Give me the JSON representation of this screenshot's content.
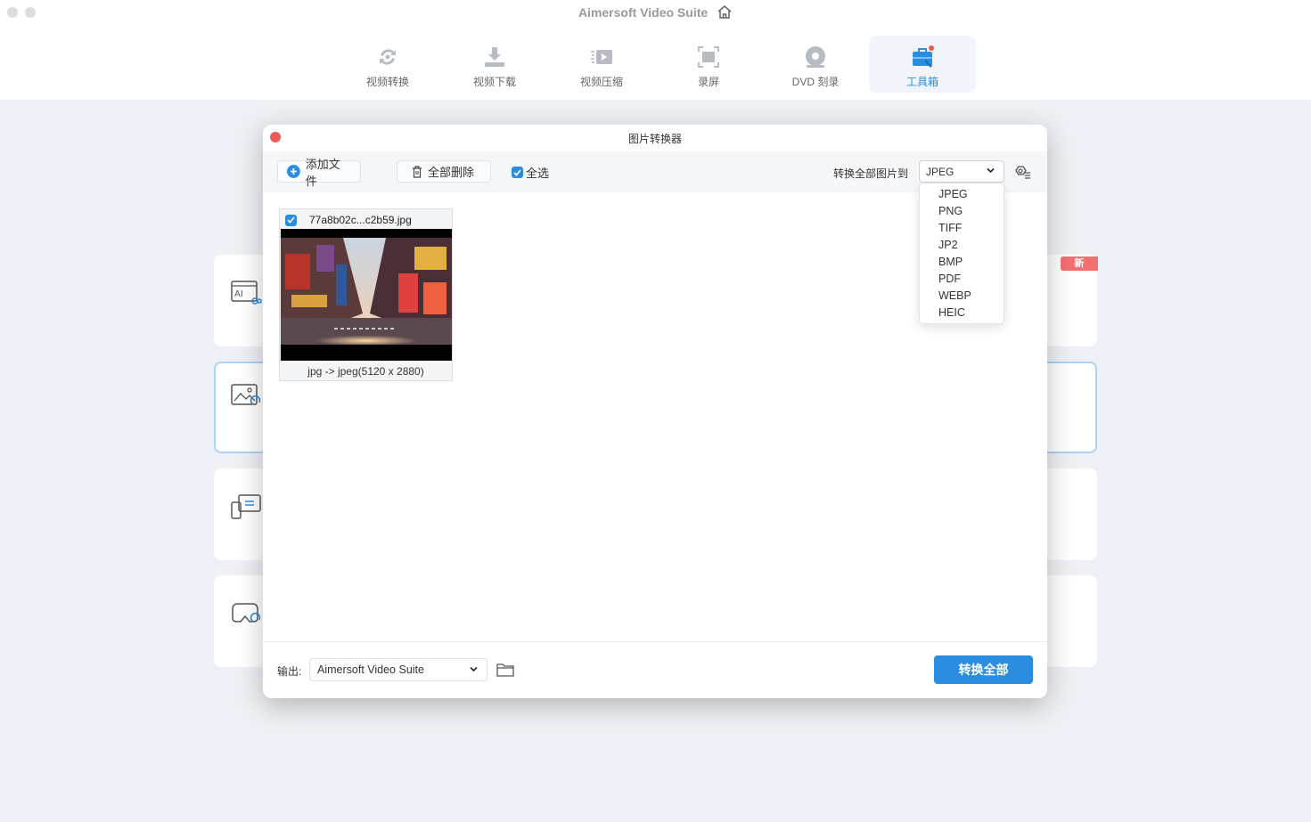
{
  "app": {
    "title": "Aimersoft Video Suite"
  },
  "nav": {
    "items": [
      {
        "label": "视频转换",
        "icon": "convert-icon"
      },
      {
        "label": "视频下载",
        "icon": "download-icon"
      },
      {
        "label": "视频压缩",
        "icon": "compress-icon"
      },
      {
        "label": "录屏",
        "icon": "screen-record-icon"
      },
      {
        "label": "DVD 刻录",
        "icon": "dvd-icon"
      },
      {
        "label": "工具箱",
        "icon": "toolbox-icon",
        "active": true
      }
    ]
  },
  "background": {
    "new_badge": "新"
  },
  "dialog": {
    "title": "图片转换器",
    "add_files": "添加文件",
    "delete_all": "全部删除",
    "select_all": "全选",
    "convert_all_to": "转换全部图片到",
    "format_selected": "JPEG",
    "format_options": [
      "JPEG",
      "PNG",
      "TIFF",
      "JP2",
      "BMP",
      "PDF",
      "WEBP",
      "HEIC"
    ],
    "file": {
      "name": "77a8b02c...c2b59.jpg",
      "info": "jpg -> jpeg(5120 x 2880)"
    },
    "output_label": "输出:",
    "output_value": "Aimersoft Video Suite",
    "convert_all_button": "转换全部"
  },
  "colors": {
    "accent": "#2a8de0",
    "close": "#ec5b56",
    "badge": "#f26f70"
  }
}
